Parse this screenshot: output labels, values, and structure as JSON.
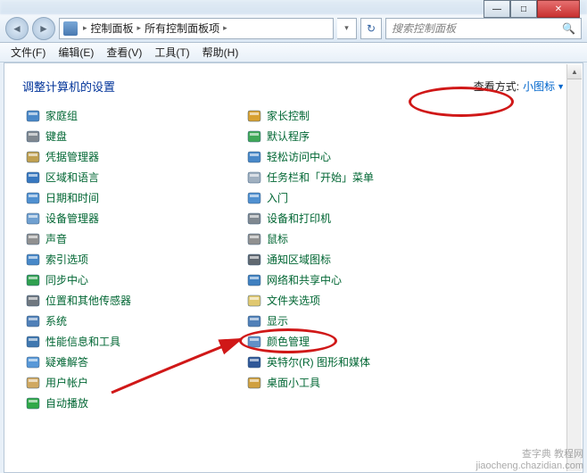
{
  "titleButtons": {
    "min": "—",
    "max": "□",
    "close": "✕"
  },
  "breadcrumb": {
    "root": "控制面板",
    "sub": "所有控制面板项"
  },
  "search": {
    "placeholder": "搜索控制面板"
  },
  "menu": {
    "file": "文件(F)",
    "edit": "编辑(E)",
    "view": "查看(V)",
    "tools": "工具(T)",
    "help": "帮助(H)"
  },
  "header": {
    "title": "调整计算机的设置",
    "viewLabel": "查看方式:",
    "viewValue": "小图标"
  },
  "colA": [
    {
      "name": "home-group",
      "label": "家庭组",
      "fill": "#4a88c8"
    },
    {
      "name": "keyboard",
      "label": "键盘",
      "fill": "#808890"
    },
    {
      "name": "credential-manager",
      "label": "凭据管理器",
      "fill": "#c0a050"
    },
    {
      "name": "region-language",
      "label": "区域和语言",
      "fill": "#3878c0"
    },
    {
      "name": "date-time",
      "label": "日期和时间",
      "fill": "#5090d0"
    },
    {
      "name": "device-manager",
      "label": "设备管理器",
      "fill": "#70a0d0"
    },
    {
      "name": "sound",
      "label": "声音",
      "fill": "#909090"
    },
    {
      "name": "indexing",
      "label": "索引选项",
      "fill": "#4888c8"
    },
    {
      "name": "sync-center",
      "label": "同步中心",
      "fill": "#30a050"
    },
    {
      "name": "location-sensors",
      "label": "位置和其他传感器",
      "fill": "#707880"
    },
    {
      "name": "system",
      "label": "系统",
      "fill": "#5080b8"
    },
    {
      "name": "performance",
      "label": "性能信息和工具",
      "fill": "#4078b0"
    },
    {
      "name": "troubleshoot",
      "label": "疑难解答",
      "fill": "#5898d8"
    },
    {
      "name": "user-accounts",
      "label": "用户帐户",
      "fill": "#d0a860"
    },
    {
      "name": "autoplay",
      "label": "自动播放",
      "fill": "#30a848"
    }
  ],
  "colB": [
    {
      "name": "parental-controls",
      "label": "家长控制",
      "fill": "#d8a030"
    },
    {
      "name": "default-programs",
      "label": "默认程序",
      "fill": "#40a858"
    },
    {
      "name": "ease-of-access",
      "label": "轻松访问中心",
      "fill": "#4888c8"
    },
    {
      "name": "taskbar-start",
      "label": "任务栏和「开始」菜单",
      "fill": "#a0b0c0"
    },
    {
      "name": "getting-started",
      "label": "入门",
      "fill": "#5090d0"
    },
    {
      "name": "devices-printers",
      "label": "设备和打印机",
      "fill": "#808890"
    },
    {
      "name": "mouse",
      "label": "鼠标",
      "fill": "#909090"
    },
    {
      "name": "notification-icons",
      "label": "通知区域图标",
      "fill": "#606870"
    },
    {
      "name": "network-sharing",
      "label": "网络和共享中心",
      "fill": "#4080c0"
    },
    {
      "name": "folder-options",
      "label": "文件夹选项",
      "fill": "#e0c870"
    },
    {
      "name": "display",
      "label": "显示",
      "fill": "#5080b8"
    },
    {
      "name": "color-management",
      "label": "颜色管理",
      "fill": "#6090c8"
    },
    {
      "name": "intel-graphics",
      "label": "英特尔(R) 图形和媒体",
      "fill": "#305898"
    },
    {
      "name": "desktop-gadgets",
      "label": "桌面小工具",
      "fill": "#d0a040"
    }
  ],
  "watermark": "查字典 教程网\njiaocheng.chazidian.com"
}
